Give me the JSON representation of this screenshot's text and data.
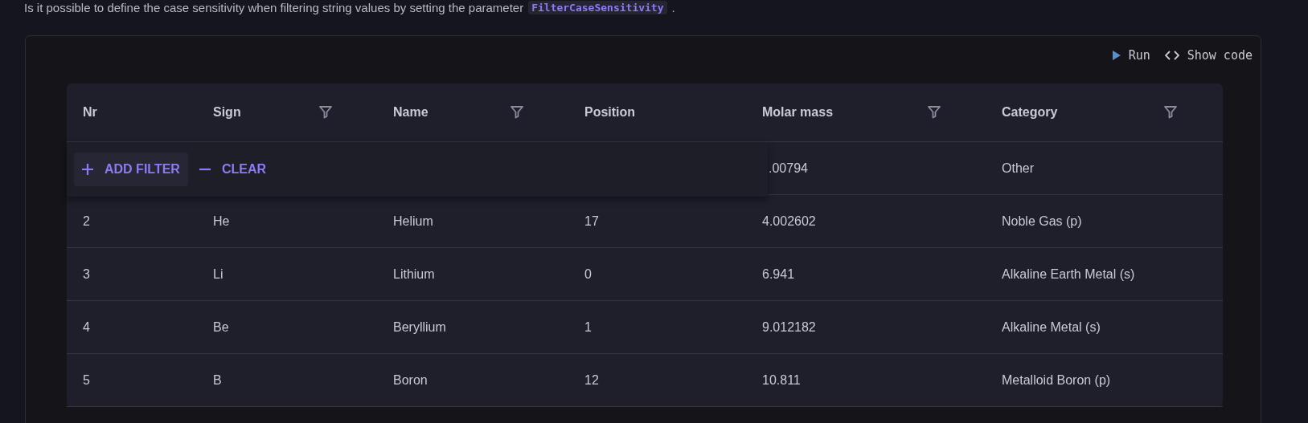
{
  "intro": {
    "text": "Is it possible to define the case sensitivity when filtering string values by setting the parameter",
    "code": "FilterCaseSensitivity",
    "end": "."
  },
  "toolbar": {
    "run": "Run",
    "show_code": "Show code"
  },
  "table": {
    "columns": [
      {
        "label": "Nr",
        "filter": false
      },
      {
        "label": "Sign",
        "filter": true
      },
      {
        "label": "Name",
        "filter": true
      },
      {
        "label": "Position",
        "filter": false
      },
      {
        "label": "Molar mass",
        "filter": true
      },
      {
        "label": "Category",
        "filter": true
      }
    ],
    "rows": [
      {
        "cells": [
          "",
          "",
          "",
          "",
          ".00794",
          "Other"
        ]
      },
      {
        "cells": [
          "2",
          "He",
          "Helium",
          "17",
          "4.002602",
          "Noble Gas (p)"
        ]
      },
      {
        "cells": [
          "3",
          "Li",
          "Lithium",
          "0",
          "6.941",
          "Alkaline Earth Metal (s)"
        ]
      },
      {
        "cells": [
          "4",
          "Be",
          "Beryllium",
          "1",
          "9.012182",
          "Alkaline Metal (s)"
        ]
      },
      {
        "cells": [
          "5",
          "B",
          "Boron",
          "12",
          "10.811",
          "Metalloid Boron (p)"
        ]
      }
    ]
  },
  "filter_popup": {
    "add": "ADD FILTER",
    "clear": "CLEAR"
  }
}
